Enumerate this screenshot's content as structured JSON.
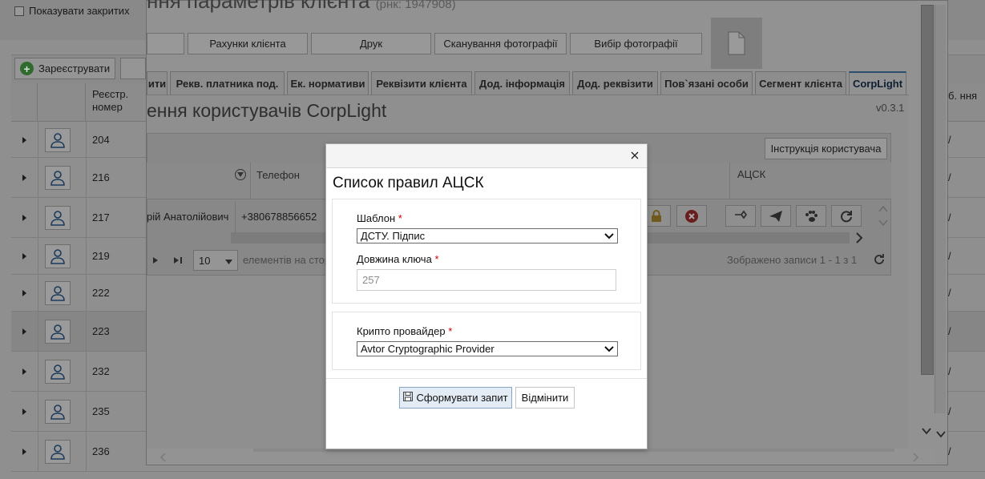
{
  "background_page": {
    "show_closed_label": "Показувати закритих",
    "register_button": "Зареєструвати",
    "reg_number_header": "Реєстр. номер",
    "right_header_fragment": "б. ння",
    "rows": [
      {
        "number": "204"
      },
      {
        "number": "216"
      },
      {
        "number": "217"
      },
      {
        "number": "219"
      },
      {
        "number": "222"
      },
      {
        "number": "223"
      },
      {
        "number": "232"
      },
      {
        "number": "235"
      },
      {
        "number": "236"
      }
    ],
    "row_suffix": "/"
  },
  "main_window": {
    "title": "ння параметрів клієнта",
    "title_sub": "(рнк: 1947908)",
    "buttons": {
      "accounts": "Рахунки клієнта",
      "print": "Друк",
      "scan": "Сканування фотографії",
      "choose": "Вибір фотографії"
    },
    "tabs": [
      {
        "label": "ити"
      },
      {
        "label": "Рекв. платника под."
      },
      {
        "label": "Ек. нормативи"
      },
      {
        "label": "Реквізити клієнта"
      },
      {
        "label": "Дод. інформація"
      },
      {
        "label": "Дод. реквізити"
      },
      {
        "label": "Пов`язані особи"
      },
      {
        "label": "Сегмент клієнта"
      },
      {
        "label": "CorpLight"
      }
    ],
    "panel": {
      "title": "ення користувачів CorpLight",
      "version": "v0.3.1",
      "instruction_button": "Інструкція користувача",
      "columns": {
        "phone": "Телефон",
        "acsk": "АЦСК"
      },
      "row": {
        "name": "рій Анатолійович",
        "phone": "+380678856652"
      },
      "pager": {
        "page_size": "10",
        "elements_text": "елементів на стор",
        "info": "Зображено записи 1 - 1 з 1"
      }
    }
  },
  "modal": {
    "title": "Список правил АЦСК",
    "template": {
      "label": "Шаблон",
      "value": "ДСТУ. Підпис"
    },
    "key_length": {
      "label": "Довжина ключа",
      "value": "257"
    },
    "crypto_provider": {
      "label": "Крипто провайдер",
      "value": "Avtor Cryptographic Provider"
    },
    "required_mark": "*",
    "generate_button": "Сформувати запит",
    "cancel_button": "Відмінити"
  },
  "colors": {
    "active_tab_border": "#2c4f6d",
    "primary_button_bg": "#e3ebf5",
    "required": "#cc0000"
  }
}
